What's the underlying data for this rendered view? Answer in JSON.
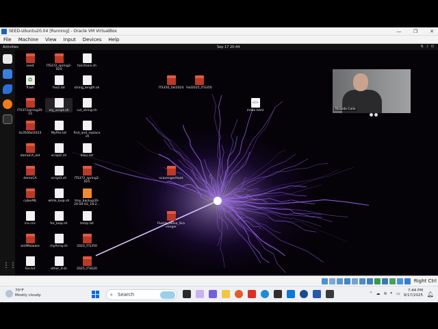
{
  "vbox": {
    "title": "SEED-Ubuntu20.04 [Running] - Oracle VM VirtualBox",
    "menu": [
      "File",
      "Machine",
      "View",
      "Input",
      "Devices",
      "Help"
    ],
    "host_key": "Right Ctrl"
  },
  "gnome": {
    "activities": "Activities",
    "clock": "Sep 17  20:44"
  },
  "desktop_icons": [
    {
      "label": "seed",
      "kind": "folder"
    },
    {
      "label": "Trash",
      "kind": "trash"
    },
    {
      "label": "ITS372spring20-23",
      "kind": "folder"
    },
    {
      "label": "its350fall2023",
      "kind": "folder"
    },
    {
      "label": "demoCA_old",
      "kind": "folder"
    },
    {
      "label": "demoCA",
      "kind": "folder"
    },
    {
      "label": "cyberML",
      "kind": "folder"
    },
    {
      "label": "iris.csv",
      "kind": "file"
    },
    {
      "label": "antiMalware",
      "kind": "folder"
    },
    {
      "label": "foo.txt",
      "kind": "file"
    },
    {
      "label": "ITS372_spring2-024",
      "kind": "folder"
    },
    {
      "label": "foo2.txt",
      "kind": "file"
    },
    {
      "label": "my_script.sh",
      "kind": "file"
    },
    {
      "label": "MyFile.txt",
      "kind": "file"
    },
    {
      "label": "script2.sh",
      "kind": "file"
    },
    {
      "label": "script3.sh",
      "kind": "file"
    },
    {
      "label": "while_loop.sh",
      "kind": "file"
    },
    {
      "label": "for_loop.sh",
      "kind": "file"
    },
    {
      "label": "myArray.sh",
      "kind": "file"
    },
    {
      "label": "other_if.sh",
      "kind": "file"
    },
    {
      "label": "functions.sh",
      "kind": "file"
    },
    {
      "label": "string_length.sh",
      "kind": "file"
    },
    {
      "label": "cut_string.sh",
      "kind": "file"
    },
    {
      "label": "find_and_replace.sh",
      "kind": "file"
    },
    {
      "label": "links.txt",
      "kind": "file"
    },
    {
      "label": "ITS372_spring2-025",
      "kind": "folder"
    },
    {
      "label": "tmp_backup20-24-04-02_18:2...",
      "kind": "orange"
    },
    {
      "label": "temp.txt",
      "kind": "file"
    },
    {
      "label": "2020_ITS350",
      "kind": "folder"
    },
    {
      "label": "2025_ITS620",
      "kind": "folder"
    },
    {
      "label": "ITS350_fall2024",
      "kind": "folder"
    },
    {
      "label": "Fall2025_ITS350",
      "kind": "folder"
    },
    {
      "label": "index.html",
      "kind": "html"
    },
    {
      "label": "scavengerHunt",
      "kind": "folder"
    },
    {
      "label": "Puzzle_Solve_Scavenger",
      "kind": "folder"
    }
  ],
  "webcam": {
    "name": "Ricardo Calix"
  },
  "taskbar": {
    "weather_temp": "70°F",
    "weather_desc": "Mostly cloudy",
    "search_placeholder": "Search",
    "time": "7:44 PM",
    "date": "9/17/2025"
  },
  "colors": {
    "bolt": "#a66bff",
    "folder": "#d94b36",
    "accent": "#0a6cd8"
  }
}
